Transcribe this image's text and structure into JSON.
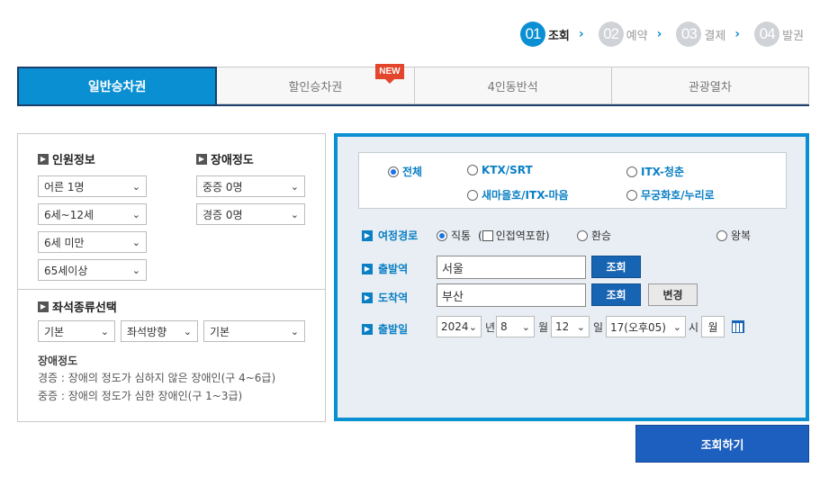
{
  "steps": [
    {
      "num": "01",
      "label": "조회",
      "active": true
    },
    {
      "num": "02",
      "label": "예약",
      "active": false
    },
    {
      "num": "03",
      "label": "결제",
      "active": false
    },
    {
      "num": "04",
      "label": "발권",
      "active": false
    }
  ],
  "tabs": [
    {
      "label": "일반승차권",
      "active": true
    },
    {
      "label": "할인승차권",
      "active": false,
      "badge": "NEW"
    },
    {
      "label": "4인동반석",
      "active": false
    },
    {
      "label": "관광열차",
      "active": false
    }
  ],
  "passenger": {
    "title": "인원정보",
    "adult": "어른 1명",
    "child": "6세~12세",
    "infant": "6세 미만",
    "senior": "65세이상"
  },
  "disability": {
    "title": "장애정도",
    "severe": "중증 0명",
    "mild": "경증 0명"
  },
  "seat": {
    "title": "좌석종류선택",
    "type": "기본",
    "direction": "좌석방향",
    "option": "기본"
  },
  "notes": {
    "title": "장애정도",
    "mild": "경증 : 장애의 정도가 심하지 않은 장애인(구 4~6급)",
    "severe": "중증 : 장애의 정도가 심한 장애인(구 1~3급)"
  },
  "train_types": {
    "all": "전체",
    "ktx": "KTX/SRT",
    "itx": "ITX-청춘",
    "saemaeul": "새마을호/ITX-마음",
    "mugunghwa": "무궁화호/누리로",
    "selected": "all"
  },
  "route": {
    "label": "여정경로",
    "direct": "직통",
    "nearby_prefix": "(",
    "nearby": "인접역포함)",
    "transfer": "환승",
    "roundtrip": "왕복"
  },
  "departure": {
    "label": "출발역",
    "value": "서울",
    "button": "조회"
  },
  "arrival": {
    "label": "도착역",
    "value": "부산",
    "button": "조회",
    "swap": "변경"
  },
  "date": {
    "label": "출발일",
    "year": "2024",
    "year_unit": "년",
    "month": "8",
    "month_unit": "월",
    "day": "12",
    "day_unit": "일",
    "hour": "17(오후05)",
    "hour_unit": "시",
    "weekday": "월"
  },
  "search_button": "조회하기",
  "colors": {
    "accent": "#0a8fd3",
    "button": "#1d5fbf",
    "badge": "#e2462c"
  }
}
